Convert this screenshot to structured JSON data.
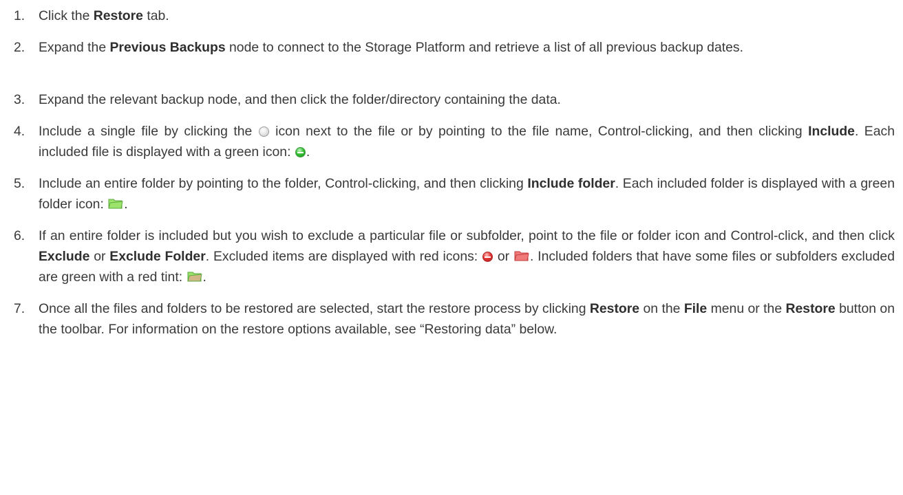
{
  "steps": [
    {
      "num": "1.",
      "parts": [
        {
          "t": "Click the "
        },
        {
          "b": "Restore"
        },
        {
          "t": " tab."
        }
      ]
    },
    {
      "num": "2.",
      "parts": [
        {
          "t": "Expand the "
        },
        {
          "b": "Previous Backups"
        },
        {
          "t": " node to connect to the Storage Platform and retrieve a list of all previous backup dates."
        }
      ]
    },
    {
      "num": "3.",
      "parts": [
        {
          "t": "Expand the relevant backup node, and then click the folder/directory containing the data."
        }
      ]
    },
    {
      "num": "4.",
      "parts": [
        {
          "t": "Include a single file by clicking the "
        },
        {
          "icon": "empty-circle-icon"
        },
        {
          "t": " icon next to the file or by pointing to the file name, Control-clicking, and then clicking "
        },
        {
          "b": "Include"
        },
        {
          "t": ".  Each included file is displayed with a green icon: "
        },
        {
          "icon": "green-circle-icon"
        },
        {
          "t": "."
        }
      ]
    },
    {
      "num": "5.",
      "parts": [
        {
          "t": "Include an entire folder by pointing to the folder, Control-clicking, and then clicking "
        },
        {
          "b": "Include folder"
        },
        {
          "t": ".  Each included folder is displayed with a green folder icon: "
        },
        {
          "icon": "green-folder-icon"
        },
        {
          "t": "."
        }
      ]
    },
    {
      "num": "6.",
      "parts": [
        {
          "t": "If an entire folder is included but you wish to exclude a particular file or subfolder, point to the file or folder icon and Control-click, and then click "
        },
        {
          "b": "Exclude"
        },
        {
          "t": " or "
        },
        {
          "b": "Exclude Folder"
        },
        {
          "t": ". Excluded items are displayed with red icons: "
        },
        {
          "icon": "red-circle-icon"
        },
        {
          "t": " or "
        },
        {
          "icon": "red-folder-icon"
        },
        {
          "t": ". Included folders that have some files or subfolders excluded are green with a red tint: "
        },
        {
          "icon": "green-red-folder-icon"
        },
        {
          "t": "."
        }
      ]
    },
    {
      "num": "7.",
      "parts": [
        {
          "t": "Once all the files and folders to be restored are selected, start the restore process by clicking "
        },
        {
          "b": "Restore"
        },
        {
          "t": " on the "
        },
        {
          "b": "File"
        },
        {
          "t": " menu or the "
        },
        {
          "b": "Restore"
        },
        {
          "t": " button on the toolbar. For information on the restore options available, see “Restoring data” below."
        }
      ]
    }
  ]
}
